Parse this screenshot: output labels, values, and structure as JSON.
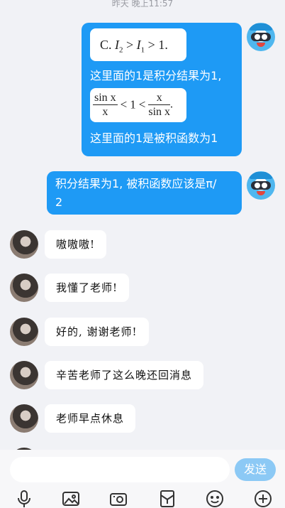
{
  "chat": {
    "timestamp": "昨天 晚上11:57",
    "messages": {
      "m1": {
        "math1": {
          "option": "C.",
          "lhs": "I",
          "lhs_sub": "2",
          "gt1": ">",
          "mid": "I",
          "mid_sub": "1",
          "gt2": ">",
          "rhs": "1."
        },
        "caption1": "这里面的1是积分结果为1,",
        "math2": {
          "frac1_num": "sin x",
          "frac1_den": "x",
          "lt1": "<",
          "one": "1",
          "lt2": "<",
          "frac2_num": "x",
          "frac2_den": "sin x",
          "end": "."
        },
        "caption2": "这里面的1是被积函数为1"
      },
      "m2": {
        "line1": "积分结果为1, 被积函数应该是π/",
        "line2": "2"
      },
      "m3": "嗷嗷嗷!",
      "m4": "我懂了老师!",
      "m5": "好的, 谢谢老师!",
      "m6": "辛苦老师了这么晚还回消息",
      "m7": "老师早点休息"
    }
  },
  "composer": {
    "input_value": "",
    "send_label": "发送",
    "tools": [
      "microphone-icon",
      "image-icon",
      "camera-icon",
      "red-packet-icon",
      "emoji-icon",
      "plus-icon"
    ]
  },
  "colors": {
    "self_bubble": "#1e9af5",
    "send_button": "#8cc9f5",
    "background": "#f1f2f6"
  }
}
